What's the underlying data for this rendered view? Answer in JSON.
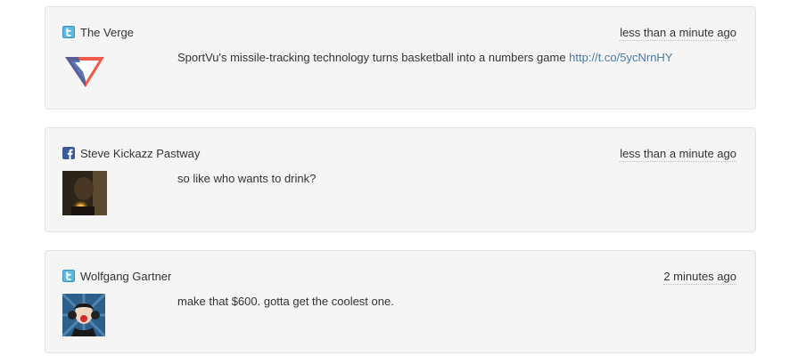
{
  "posts": [
    {
      "source": "twitter",
      "source_icon": "twitter-icon",
      "author": "The Verge",
      "time": "less than a minute ago",
      "text": "SportVu's missile-tracking technology turns basketball into a numbers game",
      "link": "http://t.co/5ycNrnHY",
      "avatar": "the-verge-logo"
    },
    {
      "source": "facebook",
      "source_icon": "facebook-icon",
      "author": "Steve Kickazz Pastway",
      "time": "less than a minute ago",
      "text": "so like who wants to drink?",
      "avatar": "user-photo"
    },
    {
      "source": "twitter",
      "source_icon": "twitter-icon",
      "author": "Wolfgang Gartner",
      "time": "2 minutes ago",
      "text": "make that $600. gotta get the coolest one.",
      "avatar": "user-avatar-illustration"
    }
  ],
  "colors": {
    "card_bg": "#f5f5f5",
    "card_border": "#e3e3e3",
    "link": "#4a7aa5",
    "twitter_blue": "#5fb8e0",
    "facebook_blue": "#3b5998"
  }
}
